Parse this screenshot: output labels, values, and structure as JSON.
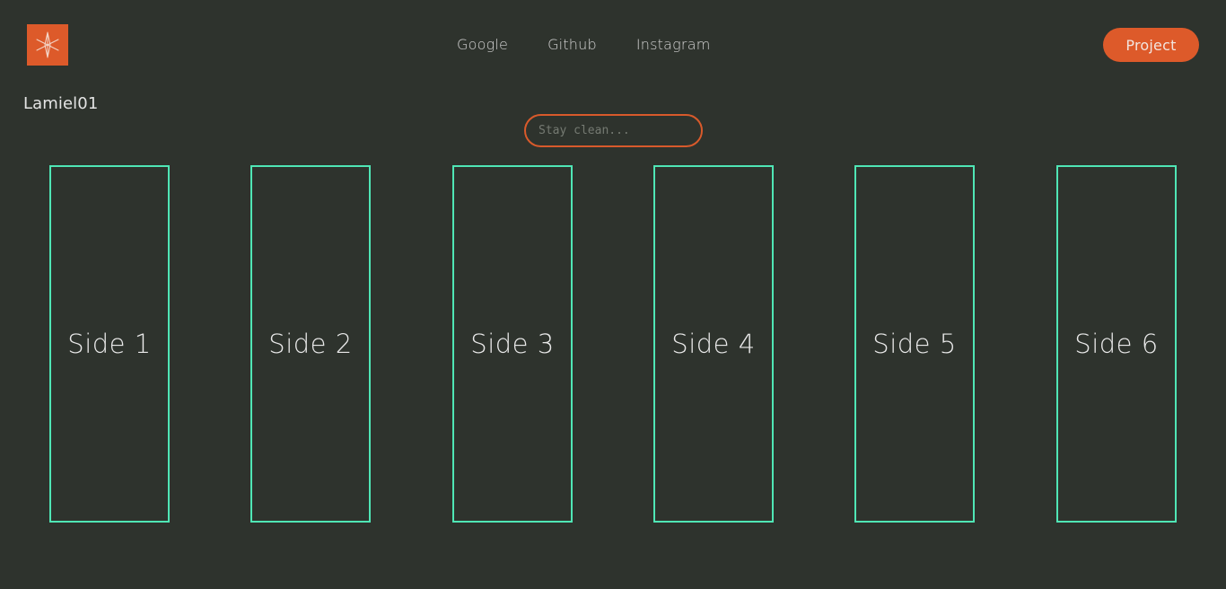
{
  "header": {
    "logo_icon": "star-compass-icon",
    "nav": [
      {
        "label": "Google"
      },
      {
        "label": "Github"
      },
      {
        "label": "Instagram"
      }
    ],
    "project_button": "Project"
  },
  "site_name": "Lamiel01",
  "search": {
    "placeholder": "Stay clean...",
    "value": ""
  },
  "sides": [
    {
      "label": "Side 1"
    },
    {
      "label": "Side 2"
    },
    {
      "label": "Side 3"
    },
    {
      "label": "Side 4"
    },
    {
      "label": "Side 5"
    },
    {
      "label": "Side 6"
    }
  ],
  "colors": {
    "background": "#2e332d",
    "accent": "#dd5a2a",
    "card_border": "#4fe6b5",
    "text": "#e4e4e4"
  }
}
